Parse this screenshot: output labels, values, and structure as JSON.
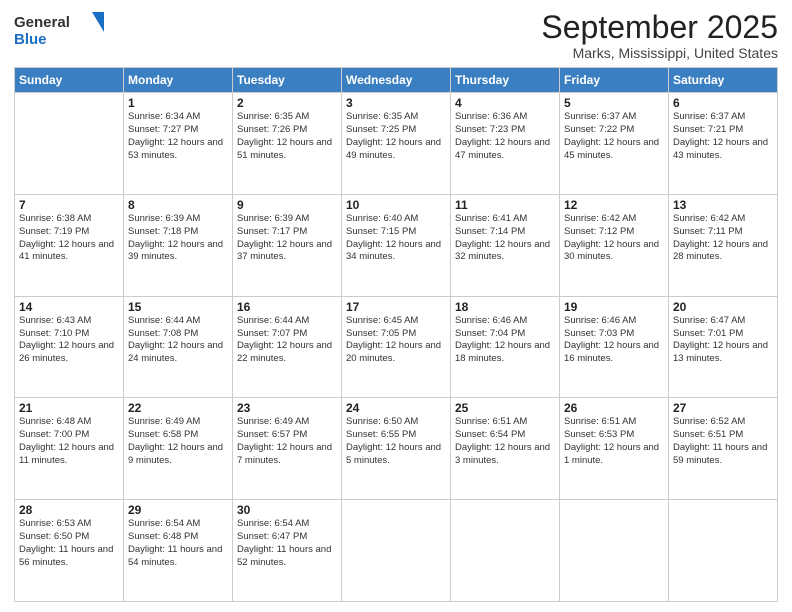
{
  "logo": {
    "line1": "General",
    "line2": "Blue"
  },
  "title": "September 2025",
  "subtitle": "Marks, Mississippi, United States",
  "weekdays": [
    "Sunday",
    "Monday",
    "Tuesday",
    "Wednesday",
    "Thursday",
    "Friday",
    "Saturday"
  ],
  "weeks": [
    [
      {
        "day": "",
        "sunrise": "",
        "sunset": "",
        "daylight": ""
      },
      {
        "day": "1",
        "sunrise": "Sunrise: 6:34 AM",
        "sunset": "Sunset: 7:27 PM",
        "daylight": "Daylight: 12 hours and 53 minutes."
      },
      {
        "day": "2",
        "sunrise": "Sunrise: 6:35 AM",
        "sunset": "Sunset: 7:26 PM",
        "daylight": "Daylight: 12 hours and 51 minutes."
      },
      {
        "day": "3",
        "sunrise": "Sunrise: 6:35 AM",
        "sunset": "Sunset: 7:25 PM",
        "daylight": "Daylight: 12 hours and 49 minutes."
      },
      {
        "day": "4",
        "sunrise": "Sunrise: 6:36 AM",
        "sunset": "Sunset: 7:23 PM",
        "daylight": "Daylight: 12 hours and 47 minutes."
      },
      {
        "day": "5",
        "sunrise": "Sunrise: 6:37 AM",
        "sunset": "Sunset: 7:22 PM",
        "daylight": "Daylight: 12 hours and 45 minutes."
      },
      {
        "day": "6",
        "sunrise": "Sunrise: 6:37 AM",
        "sunset": "Sunset: 7:21 PM",
        "daylight": "Daylight: 12 hours and 43 minutes."
      }
    ],
    [
      {
        "day": "7",
        "sunrise": "Sunrise: 6:38 AM",
        "sunset": "Sunset: 7:19 PM",
        "daylight": "Daylight: 12 hours and 41 minutes."
      },
      {
        "day": "8",
        "sunrise": "Sunrise: 6:39 AM",
        "sunset": "Sunset: 7:18 PM",
        "daylight": "Daylight: 12 hours and 39 minutes."
      },
      {
        "day": "9",
        "sunrise": "Sunrise: 6:39 AM",
        "sunset": "Sunset: 7:17 PM",
        "daylight": "Daylight: 12 hours and 37 minutes."
      },
      {
        "day": "10",
        "sunrise": "Sunrise: 6:40 AM",
        "sunset": "Sunset: 7:15 PM",
        "daylight": "Daylight: 12 hours and 34 minutes."
      },
      {
        "day": "11",
        "sunrise": "Sunrise: 6:41 AM",
        "sunset": "Sunset: 7:14 PM",
        "daylight": "Daylight: 12 hours and 32 minutes."
      },
      {
        "day": "12",
        "sunrise": "Sunrise: 6:42 AM",
        "sunset": "Sunset: 7:12 PM",
        "daylight": "Daylight: 12 hours and 30 minutes."
      },
      {
        "day": "13",
        "sunrise": "Sunrise: 6:42 AM",
        "sunset": "Sunset: 7:11 PM",
        "daylight": "Daylight: 12 hours and 28 minutes."
      }
    ],
    [
      {
        "day": "14",
        "sunrise": "Sunrise: 6:43 AM",
        "sunset": "Sunset: 7:10 PM",
        "daylight": "Daylight: 12 hours and 26 minutes."
      },
      {
        "day": "15",
        "sunrise": "Sunrise: 6:44 AM",
        "sunset": "Sunset: 7:08 PM",
        "daylight": "Daylight: 12 hours and 24 minutes."
      },
      {
        "day": "16",
        "sunrise": "Sunrise: 6:44 AM",
        "sunset": "Sunset: 7:07 PM",
        "daylight": "Daylight: 12 hours and 22 minutes."
      },
      {
        "day": "17",
        "sunrise": "Sunrise: 6:45 AM",
        "sunset": "Sunset: 7:05 PM",
        "daylight": "Daylight: 12 hours and 20 minutes."
      },
      {
        "day": "18",
        "sunrise": "Sunrise: 6:46 AM",
        "sunset": "Sunset: 7:04 PM",
        "daylight": "Daylight: 12 hours and 18 minutes."
      },
      {
        "day": "19",
        "sunrise": "Sunrise: 6:46 AM",
        "sunset": "Sunset: 7:03 PM",
        "daylight": "Daylight: 12 hours and 16 minutes."
      },
      {
        "day": "20",
        "sunrise": "Sunrise: 6:47 AM",
        "sunset": "Sunset: 7:01 PM",
        "daylight": "Daylight: 12 hours and 13 minutes."
      }
    ],
    [
      {
        "day": "21",
        "sunrise": "Sunrise: 6:48 AM",
        "sunset": "Sunset: 7:00 PM",
        "daylight": "Daylight: 12 hours and 11 minutes."
      },
      {
        "day": "22",
        "sunrise": "Sunrise: 6:49 AM",
        "sunset": "Sunset: 6:58 PM",
        "daylight": "Daylight: 12 hours and 9 minutes."
      },
      {
        "day": "23",
        "sunrise": "Sunrise: 6:49 AM",
        "sunset": "Sunset: 6:57 PM",
        "daylight": "Daylight: 12 hours and 7 minutes."
      },
      {
        "day": "24",
        "sunrise": "Sunrise: 6:50 AM",
        "sunset": "Sunset: 6:55 PM",
        "daylight": "Daylight: 12 hours and 5 minutes."
      },
      {
        "day": "25",
        "sunrise": "Sunrise: 6:51 AM",
        "sunset": "Sunset: 6:54 PM",
        "daylight": "Daylight: 12 hours and 3 minutes."
      },
      {
        "day": "26",
        "sunrise": "Sunrise: 6:51 AM",
        "sunset": "Sunset: 6:53 PM",
        "daylight": "Daylight: 12 hours and 1 minute."
      },
      {
        "day": "27",
        "sunrise": "Sunrise: 6:52 AM",
        "sunset": "Sunset: 6:51 PM",
        "daylight": "Daylight: 11 hours and 59 minutes."
      }
    ],
    [
      {
        "day": "28",
        "sunrise": "Sunrise: 6:53 AM",
        "sunset": "Sunset: 6:50 PM",
        "daylight": "Daylight: 11 hours and 56 minutes."
      },
      {
        "day": "29",
        "sunrise": "Sunrise: 6:54 AM",
        "sunset": "Sunset: 6:48 PM",
        "daylight": "Daylight: 11 hours and 54 minutes."
      },
      {
        "day": "30",
        "sunrise": "Sunrise: 6:54 AM",
        "sunset": "Sunset: 6:47 PM",
        "daylight": "Daylight: 11 hours and 52 minutes."
      },
      {
        "day": "",
        "sunrise": "",
        "sunset": "",
        "daylight": ""
      },
      {
        "day": "",
        "sunrise": "",
        "sunset": "",
        "daylight": ""
      },
      {
        "day": "",
        "sunrise": "",
        "sunset": "",
        "daylight": ""
      },
      {
        "day": "",
        "sunrise": "",
        "sunset": "",
        "daylight": ""
      }
    ]
  ]
}
